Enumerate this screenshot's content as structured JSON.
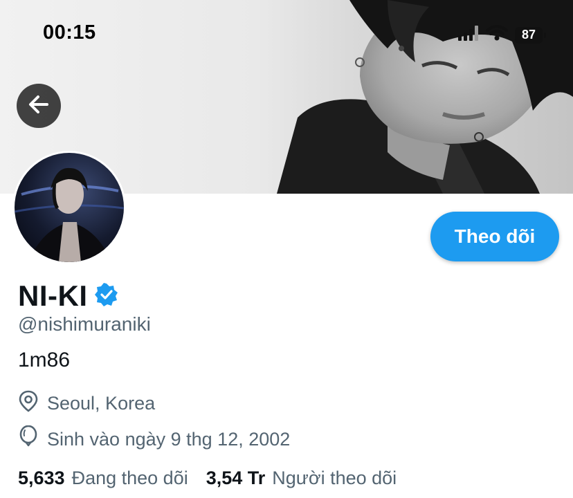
{
  "status_bar": {
    "time": "00:15",
    "battery": "87",
    "icons": [
      "signal-bars-icon",
      "wifi-icon",
      "battery-icon"
    ]
  },
  "header": {
    "back_icon": "arrow-left-icon"
  },
  "profile": {
    "display_name": "NI-KI",
    "verified_icon": "verified-badge-icon",
    "handle": "@nishimuraniki",
    "bio": "1m86",
    "location": "Seoul, Korea",
    "location_icon": "location-pin-icon",
    "birthday": "Sinh vào ngày 9 thg 12, 2002",
    "birthday_icon": "balloon-icon"
  },
  "actions": {
    "follow_label": "Theo dõi"
  },
  "stats": {
    "following_count": "5,633",
    "following_label": "Đang theo dõi",
    "followers_count": "3,54 Tr",
    "followers_label": "Người theo dõi"
  },
  "colors": {
    "accent": "#1d9bf0",
    "secondary_text": "#536471",
    "primary_text": "#0f1419"
  }
}
